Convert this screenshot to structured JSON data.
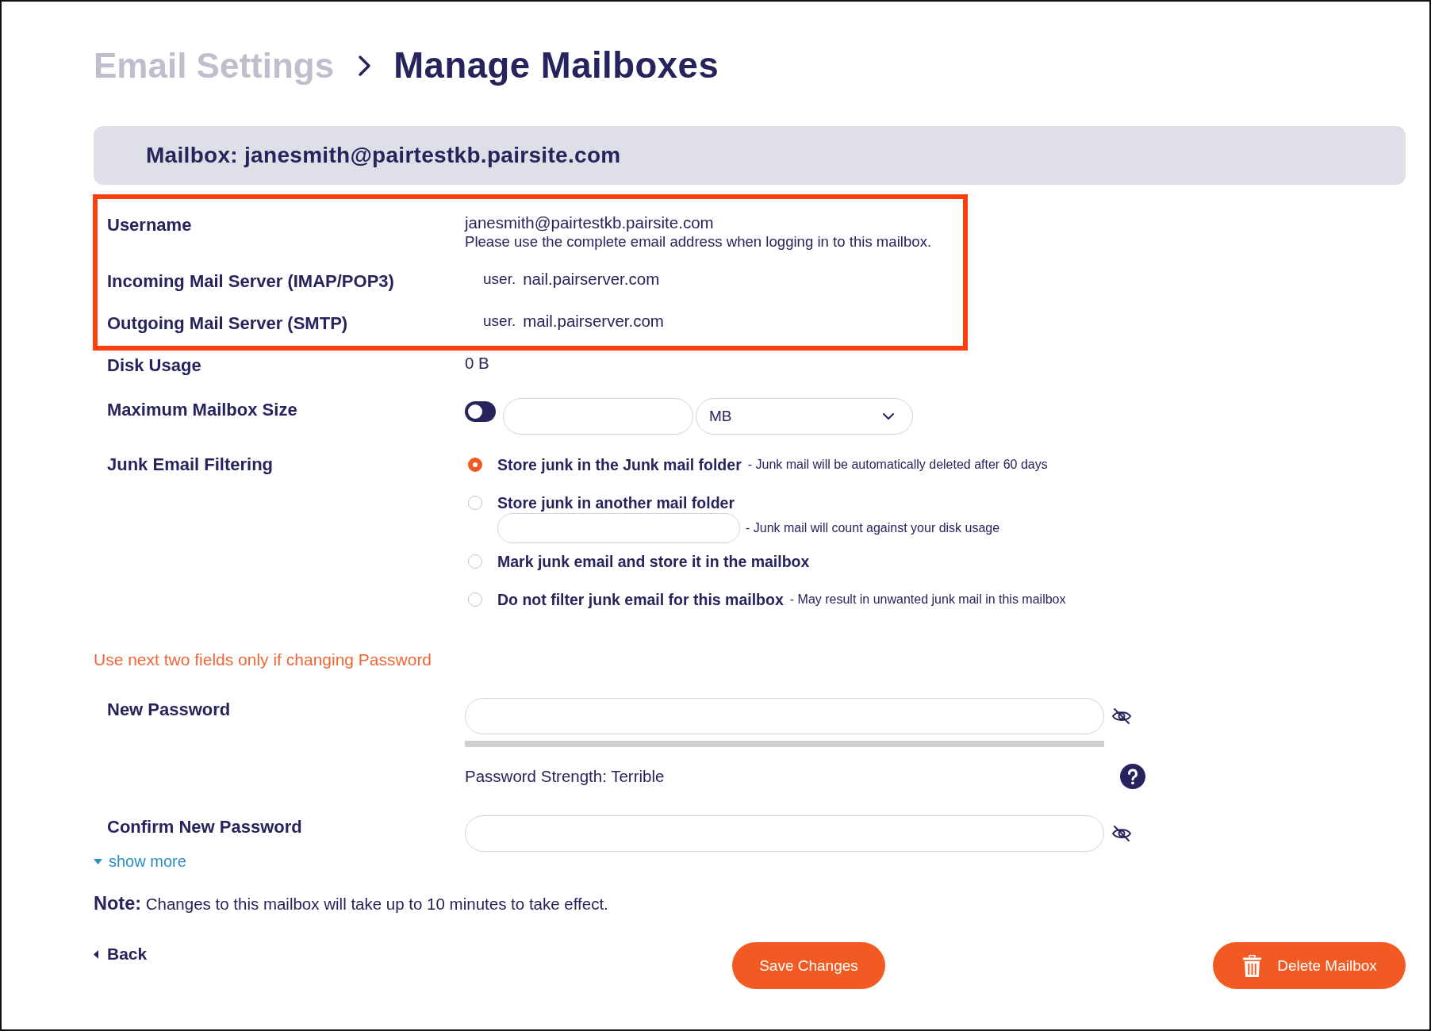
{
  "breadcrumb": [
    {
      "label": "Email Settings",
      "selected": false
    },
    {
      "label": "Manage Mailboxes",
      "selected": true
    }
  ],
  "mailbox_header": {
    "title": "Mailbox: janesmith@pairtestkb.pairsite.com"
  },
  "details": [
    {
      "kind": "text",
      "label": "Username",
      "highlighted": true,
      "value": "janesmith@pairtestkb.pairsite.com",
      "hint": "Please use the complete email address when logging in to this mailbox."
    },
    {
      "kind": "server",
      "label": "Incoming Mail Server (IMAP/POP3)",
      "highlighted": true,
      "prefix": "user.",
      "value": "nail.pairserver.com"
    },
    {
      "kind": "server",
      "label": "Outgoing Mail Server (SMTP)",
      "highlighted": true,
      "prefix": "user.",
      "value": "mail.pairserver.com"
    },
    {
      "kind": "text",
      "label": "Disk Usage",
      "highlighted": false,
      "value": "0 B"
    }
  ],
  "max_size": {
    "label": "Maximum Mailbox Size",
    "on": false,
    "unit": "MB"
  },
  "junk_filtering": {
    "label": "Junk Email Filtering",
    "options": [
      {
        "kind": "plain",
        "label": "Store junk in the Junk mail folder",
        "note": "- Junk mail will be automatically deleted after 60 days",
        "selected": true
      },
      {
        "kind": "with_field",
        "label": "Store junk in another mail folder",
        "note": "- Junk mail will count against your disk usage",
        "selected": false
      },
      {
        "kind": "plain",
        "label": "Mark junk email and store it in the mailbox",
        "selected": false
      },
      {
        "kind": "plain",
        "label": "Do not filter junk email for this mailbox",
        "note": "- May result in unwanted junk mail in this mailbox",
        "selected": false
      }
    ]
  },
  "password": {
    "warning": "Use next two fields only if changing Password",
    "new_label": "New Password",
    "strength": {
      "level": 0,
      "text": "Password Strength: Terrible"
    },
    "confirm_label": "Confirm New Password"
  },
  "show_more": {
    "label": "show more",
    "expanded": false
  },
  "note": "**Note:** Changes to this mailbox will take up to 10 minutes to take effect.",
  "actions": {
    "back": "Back",
    "save": "Save Changes",
    "delete": "Delete Mailbox"
  }
}
